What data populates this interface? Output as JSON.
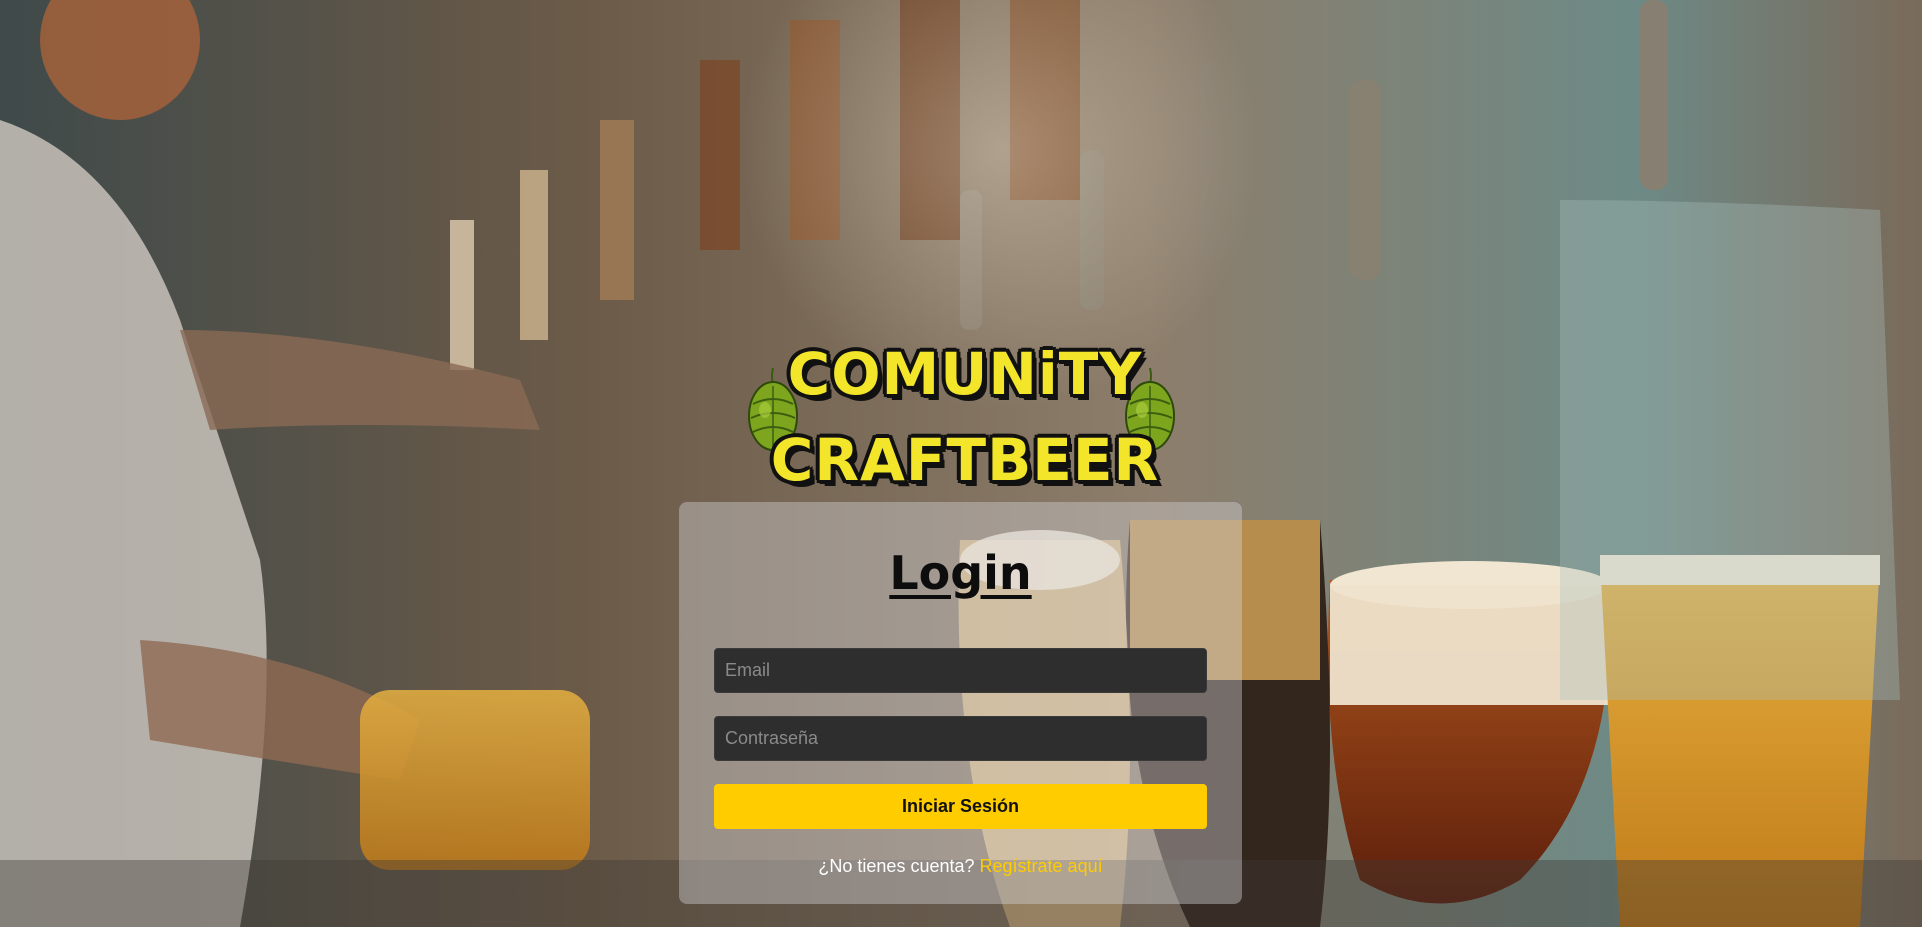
{
  "brand": {
    "line1": "COMUNiTY",
    "line2": "CRAFTBEER",
    "logo_color": "#f2e52a"
  },
  "login": {
    "title": "Login",
    "email_placeholder": "Email",
    "password_placeholder": "Contraseña",
    "submit_label": "Iniciar Sesión",
    "signup_prompt": "¿No tienes cuenta?",
    "signup_link": "Regístrate aquí"
  },
  "colors": {
    "accent": "#ffcc00",
    "input_bg": "#2e2e2e",
    "card_bg": "rgba(210,210,215,0.42)"
  },
  "icons": {
    "left": "hop-icon",
    "right": "hop-icon"
  }
}
